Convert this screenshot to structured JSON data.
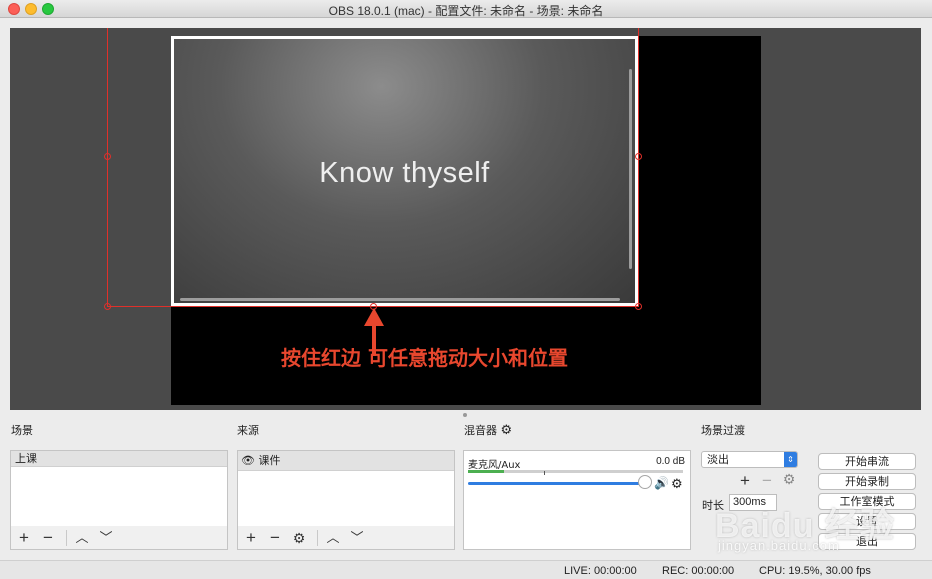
{
  "window": {
    "title": "OBS 18.0.1 (mac) - 配置文件: 未命名 - 场景: 未命名"
  },
  "preview": {
    "source_text": "Know thyself",
    "annotation": "按住红边 可任意拖动大小和位置",
    "annotation_color": "#e8472e",
    "selection_color": "#e0302a"
  },
  "scenes": {
    "title": "场景",
    "items": [
      "上课"
    ]
  },
  "sources": {
    "title": "来源",
    "items": [
      {
        "label": "课件",
        "visible_icon": "eye-icon"
      }
    ]
  },
  "mixer": {
    "title": "混音器",
    "channels": [
      {
        "name": "麦克风/Aux",
        "db": "0.0 dB",
        "volume": 1.0
      }
    ]
  },
  "transitions": {
    "title": "场景过渡",
    "selected": "淡出",
    "duration_label": "时长",
    "duration_value": "300ms"
  },
  "controls": {
    "start_stream": "开始串流",
    "start_record": "开始录制",
    "studio_mode": "工作室模式",
    "settings": "设置",
    "exit": "退出"
  },
  "status": {
    "live": "LIVE: 00:00:00",
    "rec": "REC: 00:00:00",
    "cpu": "CPU: 19.5%, 30.00 fps"
  },
  "watermark": {
    "brand": "Baidu 经验",
    "url": "jingyan.baidu.com"
  }
}
